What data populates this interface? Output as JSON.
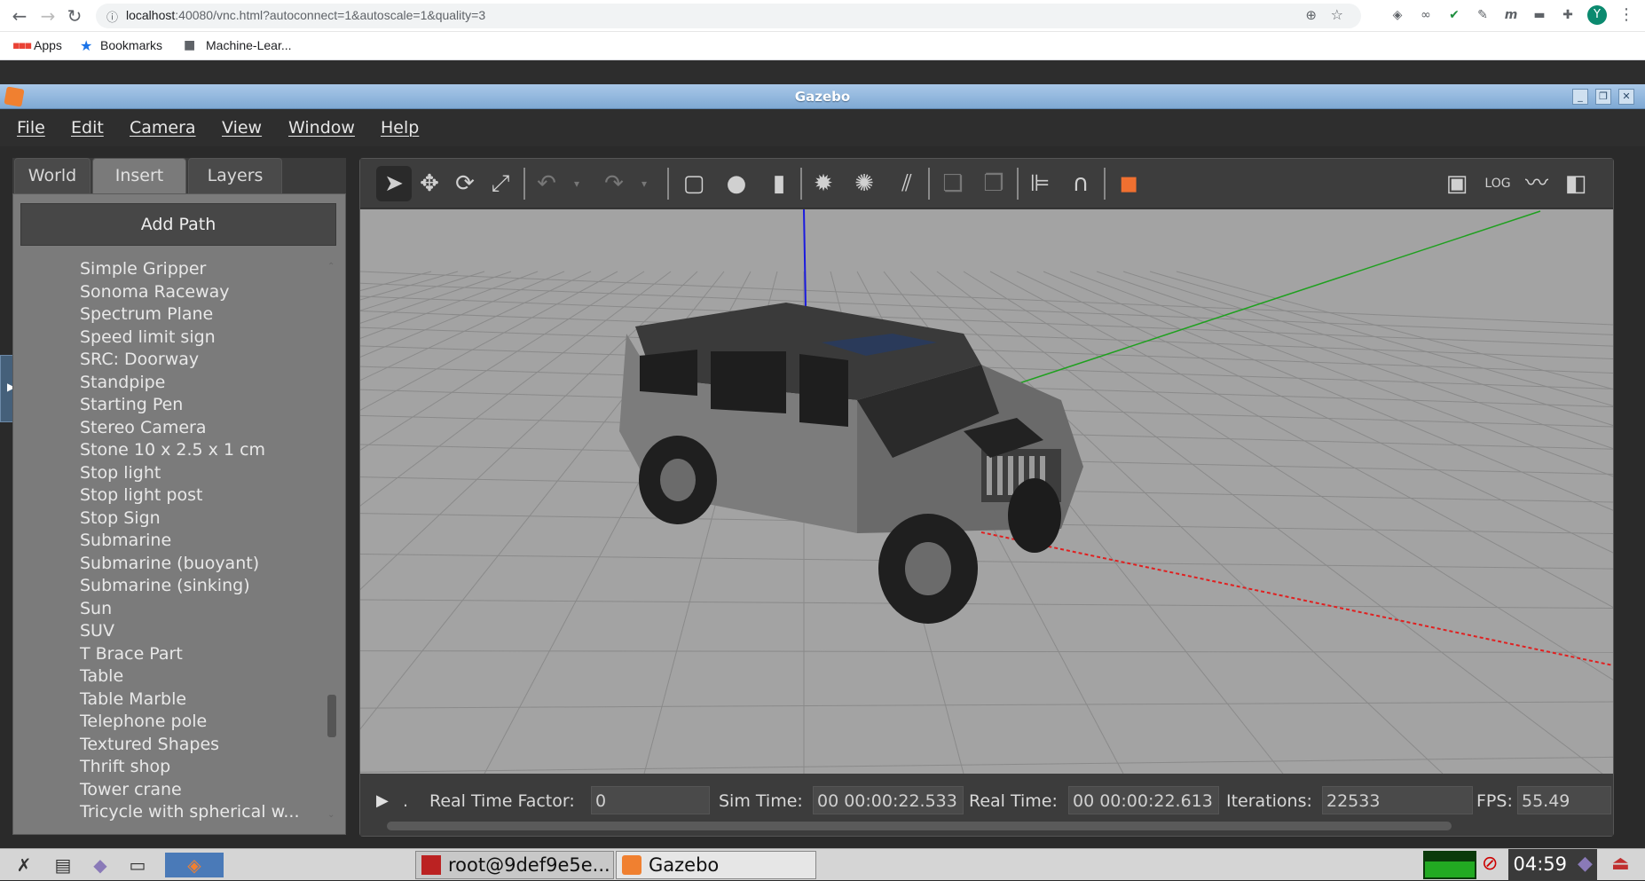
{
  "browser": {
    "url_host": "localhost",
    "url_rest": ":40080/vnc.html?autoconnect=1&autoscale=1&quality=3",
    "bookmarks": [
      "Apps",
      "Bookmarks",
      "Machine-Lear..."
    ],
    "profile_initial": "Y"
  },
  "window": {
    "title": "Gazebo"
  },
  "menu": [
    "File",
    "Edit",
    "Camera",
    "View",
    "Window",
    "Help"
  ],
  "left_panel": {
    "tabs": [
      "World",
      "Insert",
      "Layers"
    ],
    "active_tab": "Insert",
    "add_path_label": "Add Path",
    "models": [
      "Simple Gripper",
      "Sonoma Raceway",
      "Spectrum Plane",
      "Speed limit sign",
      "SRC: Doorway",
      "Standpipe",
      "Starting Pen",
      "Stereo Camera",
      "Stone 10 x 2.5 x 1 cm",
      "Stop light",
      "Stop light post",
      "Stop Sign",
      "Submarine",
      "Submarine (buoyant)",
      "Submarine (sinking)",
      "Sun",
      "SUV",
      "T Brace Part",
      "Table",
      "Table Marble",
      "Telephone pole",
      "Textured Shapes",
      "Thrift shop",
      "Tower crane",
      "Tricycle with spherical w..."
    ]
  },
  "status": {
    "rtf_label": "Real Time Factor:",
    "rtf_value": "0",
    "sim_label": "Sim Time:",
    "sim_value": "00 00:00:22.533",
    "real_label": "Real Time:",
    "real_value": "00 00:00:22.613",
    "iter_label": "Iterations:",
    "iter_value": "22533",
    "fps_label": "FPS:",
    "fps_value": "55.49"
  },
  "taskbar": {
    "terminal_label": "root@9def9e5e...",
    "gazebo_label": "Gazebo",
    "clock": "04:59"
  },
  "colors": {
    "x_axis": "#e02020",
    "y_axis": "#1fa01f",
    "z_axis": "#1a1adf",
    "accent": "#f07030"
  }
}
